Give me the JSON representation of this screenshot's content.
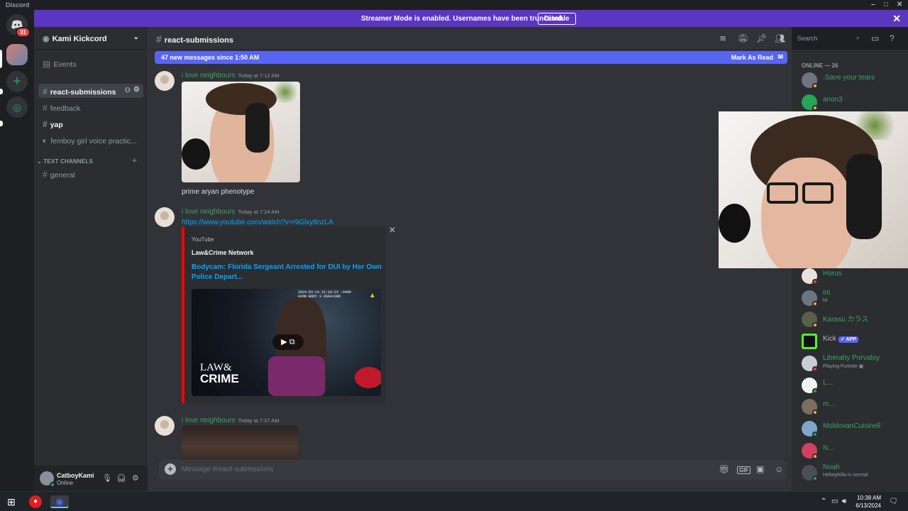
{
  "window": {
    "title": "Discord"
  },
  "streamer_banner": {
    "message": "Streamer Mode is enabled. Usernames have been truncated.",
    "button": "Disable"
  },
  "guilds": {
    "badge": "31"
  },
  "server": {
    "name": "Kami Kickcord",
    "channels": [
      {
        "name": "Events",
        "type": "events"
      },
      {
        "name": "react-submissions",
        "type": "text",
        "active": true
      },
      {
        "name": "feedback",
        "type": "text"
      },
      {
        "name": "yap",
        "type": "text",
        "unread": true
      },
      {
        "name": "femboy girl voice practic...",
        "type": "voice"
      }
    ],
    "category": "TEXT CHANNELS",
    "category_channels": [
      {
        "name": "general",
        "type": "text"
      }
    ]
  },
  "user_panel": {
    "name": "CatboyKami",
    "status": "Online"
  },
  "chat": {
    "channel": "react-submissions",
    "search_placeholder": "Search",
    "new_messages": "47 new messages since 1:50 AM",
    "mark_read": "Mark As Read",
    "messages": [
      {
        "author": "i love neighbours",
        "time": "Today at 7:12 AM",
        "text": "prime aryan phenotype"
      },
      {
        "author": "i love neighbours",
        "time": "Today at 7:24 AM",
        "link": "https://www.youtube.com/watch?v=r9Glxy8nzLA",
        "embed": {
          "provider": "YouTube",
          "author": "Law&Crime Network",
          "title": "Bodycam: Florida Sergeant Arrested for DUI by Her Own Police Depart...",
          "watermark_top": "2024-03-14 21:18:23 -0400",
          "watermark_bottom": "AXON BODY 3 X6A4J38N",
          "logo_top": "LAW&",
          "logo_bottom": "CRIME"
        }
      },
      {
        "author": "i love neighbours",
        "time": "Today at 7:37 AM"
      }
    ],
    "composer_placeholder": "Message #react-submissions"
  },
  "members": {
    "header": "ONLINE — 26",
    "list": [
      {
        "name": ".Save your tears",
        "status": "idle"
      },
      {
        "name": "anon3",
        "status": "idle"
      },
      {
        "name": "Horus",
        "status": "dnd"
      },
      {
        "name": "ini",
        "sub": "lvl",
        "status": "idle"
      },
      {
        "name": "Karasu カラス",
        "status": "idle"
      },
      {
        "name": "Kick",
        "badge": "APP",
        "status": "none",
        "plain": true
      },
      {
        "name": "Liberahy Porvaloy",
        "sub": "Playing Fortnite",
        "status": "dnd"
      },
      {
        "name": "L...",
        "status": "on"
      },
      {
        "name": "m...",
        "status": "idle"
      },
      {
        "name": "MoldovanCuisinell",
        "status": "on"
      },
      {
        "name": "N...",
        "status": "idle"
      },
      {
        "name": "Noah",
        "sub": "Hebephilia is normal",
        "status": "on"
      }
    ]
  },
  "taskbar": {
    "time": "10:38 AM",
    "date": "6/13/2024"
  },
  "colors": {
    "blurple": "#5865f2",
    "streamer": "#5b36c2",
    "green_name": "#3ba55c",
    "link": "#00a8fc",
    "embed_bar": "#ff0000"
  }
}
